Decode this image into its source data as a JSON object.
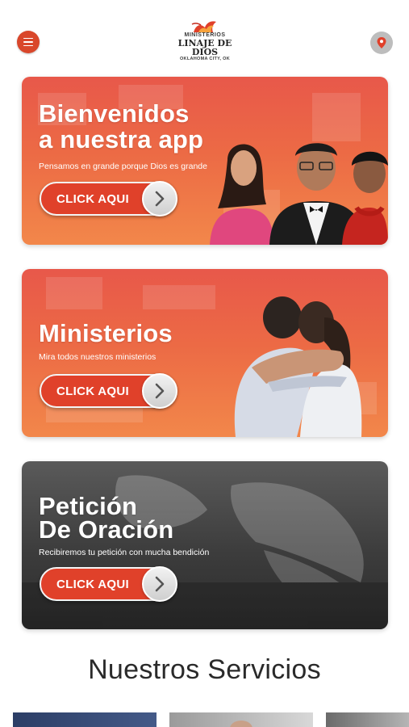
{
  "header": {
    "logo_top": "MINISTERIOS",
    "logo_main": "LINAJE DE DIOS",
    "logo_sub": "OKLAHOMA CITY, OK",
    "menu_icon": "hamburger-menu-icon",
    "location_icon": "map-pin-icon"
  },
  "cards": [
    {
      "title_line1": "Bienvenidos",
      "title_line2": "a nuestra app",
      "subtitle": "Pensamos en grande porque Dios es grande",
      "cta": "CLICK AQUI"
    },
    {
      "title_line1": "Ministerios",
      "subtitle": "Mira todos nuestros ministerios",
      "cta": "CLICK AQUI"
    },
    {
      "title_line1": "Petición",
      "title_line2": "De Oración",
      "subtitle": "Recibiremos tu petición con mucha bendición",
      "cta": "CLICK AQUI"
    }
  ],
  "section": {
    "title": "Nuestros Servicios"
  },
  "colors": {
    "accent": "#d9472b",
    "card_orange": "#ec6a45",
    "card_dark": "#3c3c3c"
  }
}
